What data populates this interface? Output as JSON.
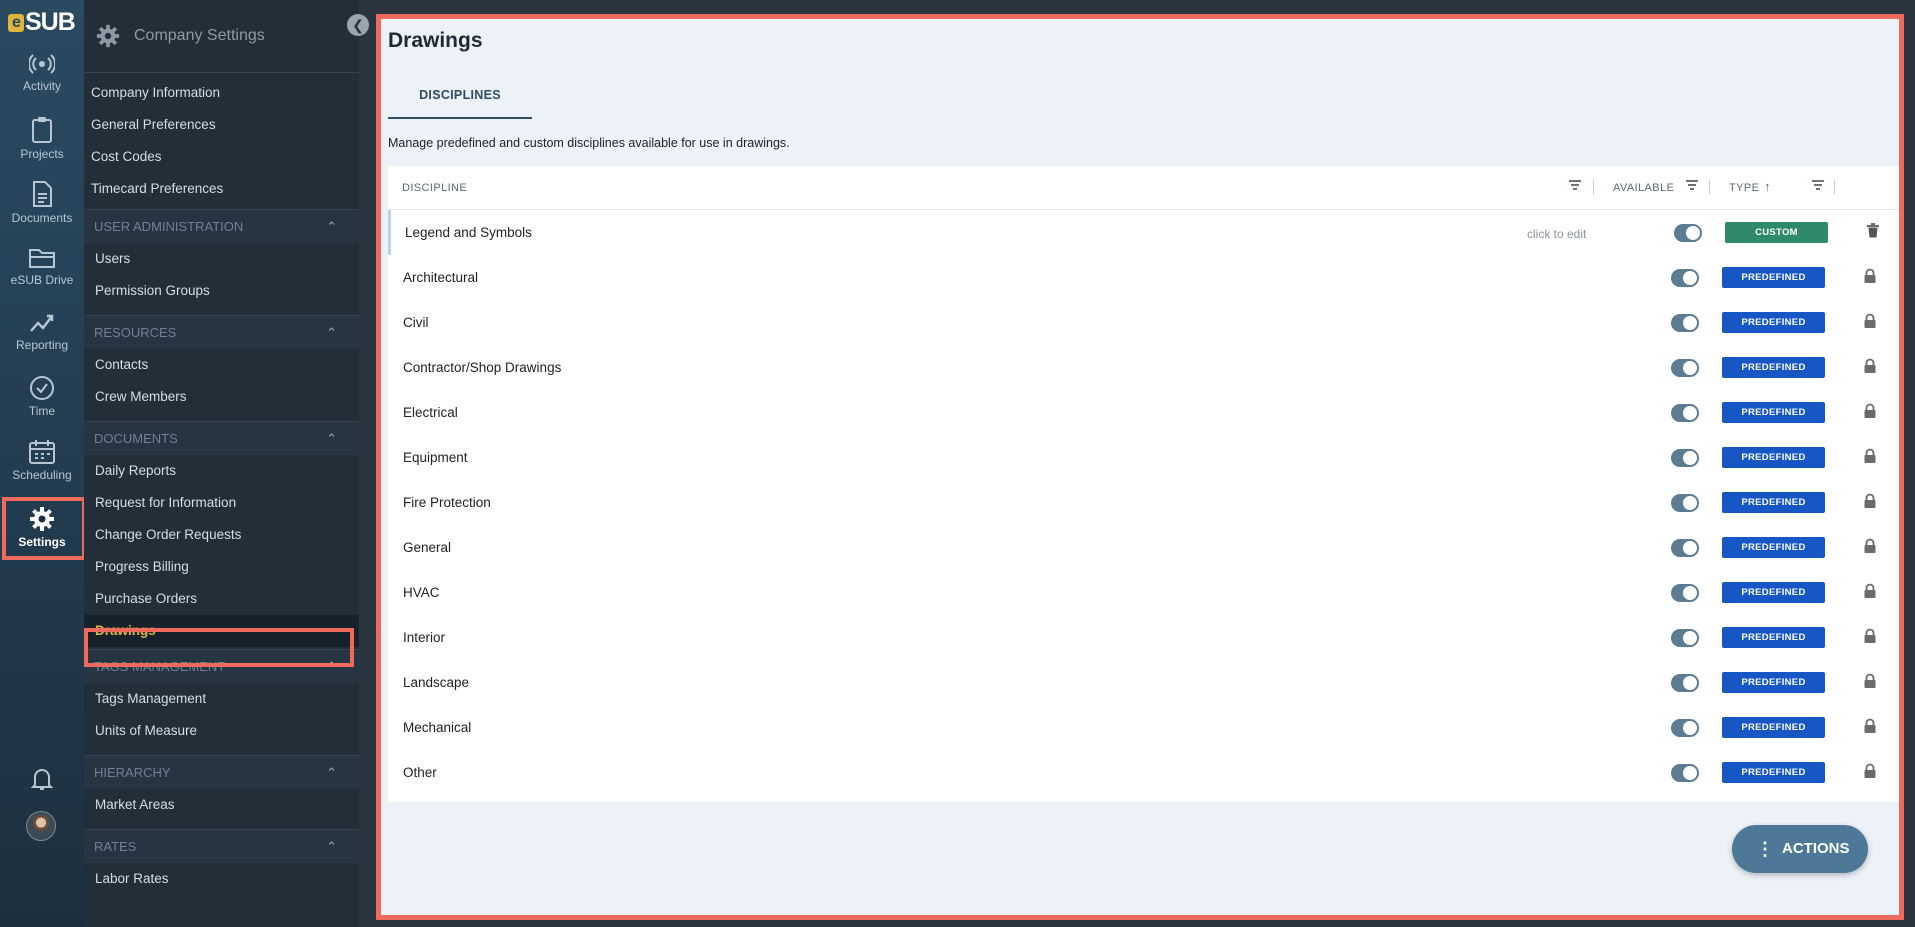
{
  "app": {
    "logo_text": "SUB",
    "logo_e": "e"
  },
  "rail": {
    "items": [
      {
        "label": "Activity",
        "icon": "activity-icon"
      },
      {
        "label": "Projects",
        "icon": "clipboard-icon"
      },
      {
        "label": "Documents",
        "icon": "document-icon"
      },
      {
        "label": "eSUB Drive",
        "icon": "folder-icon"
      },
      {
        "label": "Reporting",
        "icon": "chart-line-icon"
      },
      {
        "label": "Time",
        "icon": "clock-icon"
      },
      {
        "label": "Scheduling",
        "icon": "calendar-icon"
      },
      {
        "label": "Settings",
        "icon": "gear-icon",
        "active": true
      }
    ]
  },
  "sidebar": {
    "title": "Company Settings",
    "links": [
      "Company Information",
      "General Preferences",
      "Cost Codes",
      "Timecard Preferences"
    ],
    "sections": [
      {
        "title": "USER ADMINISTRATION",
        "items": [
          "Users",
          "Permission Groups"
        ]
      },
      {
        "title": "RESOURCES",
        "items": [
          "Contacts",
          "Crew Members"
        ]
      },
      {
        "title": "DOCUMENTS",
        "items": [
          "Daily Reports",
          "Request for Information",
          "Change Order Requests",
          "Progress Billing",
          "Purchase Orders",
          "Drawings"
        ]
      },
      {
        "title": "TAGS MANAGEMENT",
        "items": [
          "Tags Management",
          "Units of Measure"
        ]
      },
      {
        "title": "HIERARCHY",
        "items": [
          "Market Areas"
        ]
      },
      {
        "title": "RATES",
        "items": [
          "Labor Rates"
        ]
      }
    ],
    "active_item": "Drawings"
  },
  "main": {
    "title": "Drawings",
    "tab": "DISCIPLINES",
    "description": "Manage predefined and custom disciplines available for use in drawings.",
    "columns": {
      "discipline": "DISCIPLINE",
      "available": "AVAILABLE",
      "type": "TYPE"
    },
    "rows": [
      {
        "name": "Legend and Symbols",
        "hint": "click to edit",
        "type": "CUSTOM",
        "available": true
      },
      {
        "name": "Architectural",
        "type": "PREDEFINED",
        "available": true
      },
      {
        "name": "Civil",
        "type": "PREDEFINED",
        "available": true
      },
      {
        "name": "Contractor/Shop Drawings",
        "type": "PREDEFINED",
        "available": true
      },
      {
        "name": "Electrical",
        "type": "PREDEFINED",
        "available": true
      },
      {
        "name": "Equipment",
        "type": "PREDEFINED",
        "available": true
      },
      {
        "name": "Fire Protection",
        "type": "PREDEFINED",
        "available": true
      },
      {
        "name": "General",
        "type": "PREDEFINED",
        "available": true
      },
      {
        "name": "HVAC",
        "type": "PREDEFINED",
        "available": true
      },
      {
        "name": "Interior",
        "type": "PREDEFINED",
        "available": true
      },
      {
        "name": "Landscape",
        "type": "PREDEFINED",
        "available": true
      },
      {
        "name": "Mechanical",
        "type": "PREDEFINED",
        "available": true
      },
      {
        "name": "Other",
        "type": "PREDEFINED",
        "available": true
      }
    ],
    "actions_label": "ACTIONS"
  },
  "colors": {
    "accent": "#ee6a5c",
    "custom": "#2e8a6a",
    "predefined": "#1656c5",
    "active_link": "#e0b53a"
  }
}
